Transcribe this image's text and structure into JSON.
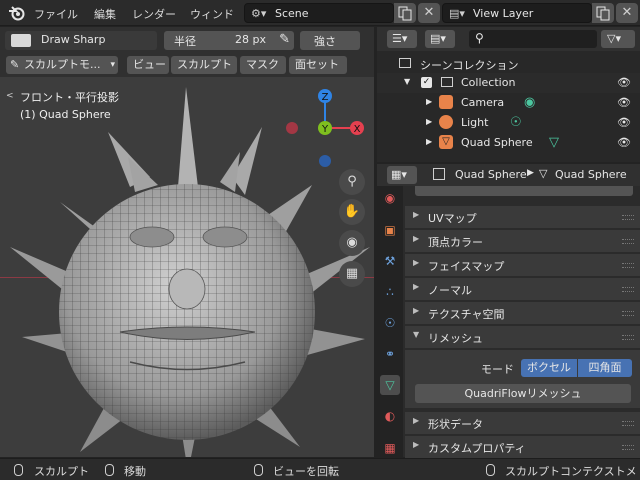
{
  "topbar": {
    "menus": [
      "ファイル",
      "編集",
      "レンダー",
      "ウィンド"
    ],
    "scene": "Scene",
    "view_layer": "View Layer"
  },
  "tool_header": {
    "brush_name": "Draw Sharp",
    "radius_label": "半径",
    "radius_value": "28 px",
    "strength_label": "強さ"
  },
  "viewport_header": {
    "mode": "スカルプトモ...",
    "menus": [
      "ビュー",
      "スカルプト",
      "マスク",
      "面セット"
    ]
  },
  "viewport": {
    "view_label": "フロント・平行投影",
    "object_label": "(1) Quad Sphere",
    "gizmo": {
      "x": "X",
      "y": "Y",
      "z": "Z"
    },
    "x_color": "#e5404f",
    "y_color": "#7fbf1f",
    "z_color": "#2f84e6"
  },
  "outliner": {
    "title": "シーンコレクション",
    "items": [
      {
        "label": "Collection"
      },
      {
        "label": "Camera"
      },
      {
        "label": "Light"
      },
      {
        "label": "Quad Sphere"
      }
    ]
  },
  "properties": {
    "breadcrumb_object": "Quad Sphere",
    "breadcrumb_data": "Quad Sphere",
    "panels_top": [
      "UVマップ",
      "頂点カラー",
      "フェイスマップ",
      "ノーマル",
      "テクスチャ空間"
    ],
    "remesh": {
      "title": "リメッシュ",
      "mode_label": "モード",
      "voxel": "ボクセル",
      "quad": "四角面",
      "quadriflow": "QuadriFlowリメッシュ"
    },
    "panels_bottom": [
      "形状データ",
      "カスタムプロパティ"
    ]
  },
  "statusbar": {
    "left_action": "スカルプト",
    "middle_action": "移動",
    "rotate_action": "ビューを回転",
    "context_action": "スカルプトコンテクストメ"
  },
  "accent": "#4772b3"
}
